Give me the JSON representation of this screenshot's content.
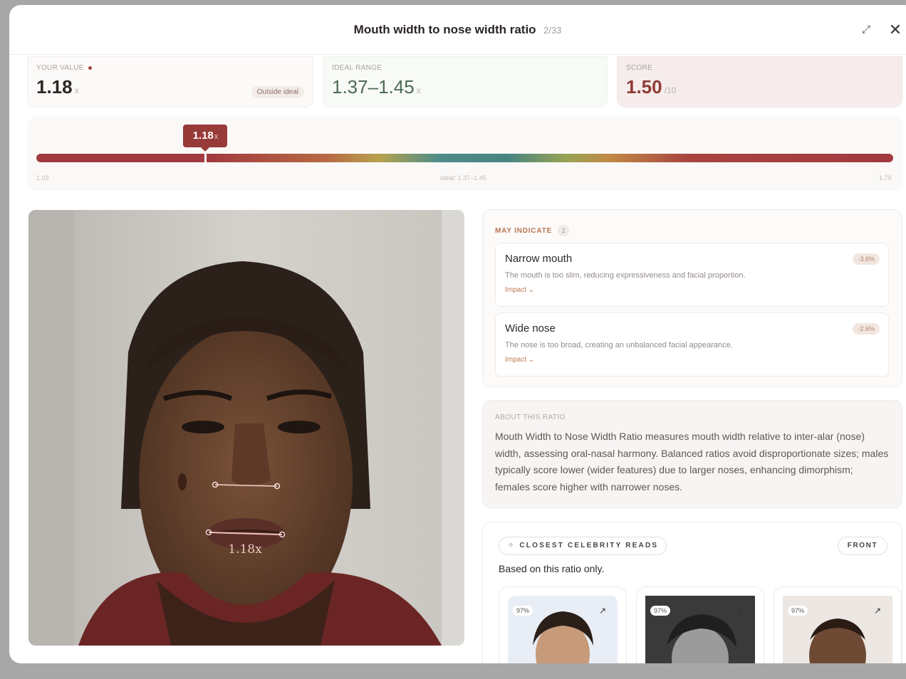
{
  "header": {
    "title": "Mouth width to nose width ratio",
    "counter": "2/33",
    "expand_icon": "expand-icon",
    "close_icon": "close-icon"
  },
  "stats": {
    "your_value": {
      "label": "YOUR VALUE",
      "value": "1.18",
      "unit": "x",
      "badge": "Outside ideal"
    },
    "ideal_range": {
      "label": "IDEAL RANGE",
      "value": "1.37–1.45",
      "unit": "x"
    },
    "score": {
      "label": "SCORE",
      "value": "1.50",
      "unit": "/10"
    }
  },
  "range": {
    "marker_label": "1.18",
    "marker_unit": "x",
    "marker_value": 1.18,
    "min_value": 1.03,
    "max_value": 1.79,
    "min_label": "1.03",
    "mid_label": "Ideal: 1.37–1.45",
    "max_label": "1.79"
  },
  "photo": {
    "measure_label": "1.18x"
  },
  "may_indicate": {
    "label": "MAY INDICATE",
    "count": "2",
    "items": [
      {
        "title": "Narrow mouth",
        "description": "The mouth is too slim, reducing expressiveness and facial proportion.",
        "impact": "Impact",
        "delta": "-3.6%"
      },
      {
        "title": "Wide nose",
        "description": "The nose is too broad, creating an unbalanced facial appearance.",
        "impact": "Impact",
        "delta": "-2.6%"
      }
    ]
  },
  "about": {
    "label": "ABOUT THIS RATIO",
    "text": "Mouth Width to Nose Width Ratio measures mouth width relative to inter-alar (nose) width, assessing oral-nasal harmony. Balanced ratios avoid disproportionate sizes; males typically score lower (wider features) due to larger noses, enhancing dimorphism; females score higher with narrower noses."
  },
  "celebrity": {
    "pill_label": "CLOSEST CELEBRITY READS",
    "pill_icon": "sparkle-icon",
    "front_label": "FRONT",
    "subtitle": "Based on this ratio only.",
    "tiles": [
      {
        "pct": "97%"
      },
      {
        "pct": "97%"
      },
      {
        "pct": "97%"
      }
    ]
  }
}
